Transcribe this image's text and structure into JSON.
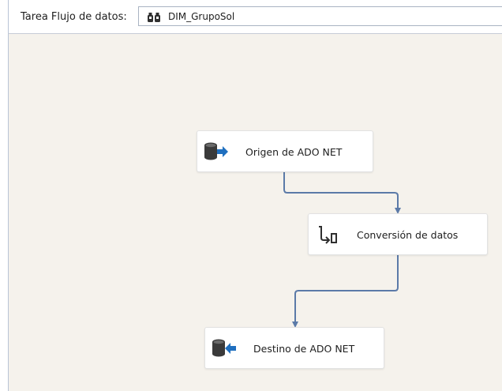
{
  "header": {
    "label": "Tarea Flujo de datos:",
    "task_name": "DIM_GrupoSol",
    "task_icon": "data-flow-task-icon"
  },
  "canvas": {
    "background": "#f5f2ec",
    "path_color": "#5b7aa8"
  },
  "components": {
    "source": {
      "label": "Origen de ADO NET",
      "icon": "ado-net-source-icon"
    },
    "conversion": {
      "label": "Conversión de datos",
      "icon": "data-conversion-icon"
    },
    "destination": {
      "label": "Destino de ADO NET",
      "icon": "ado-net-destination-icon"
    }
  }
}
